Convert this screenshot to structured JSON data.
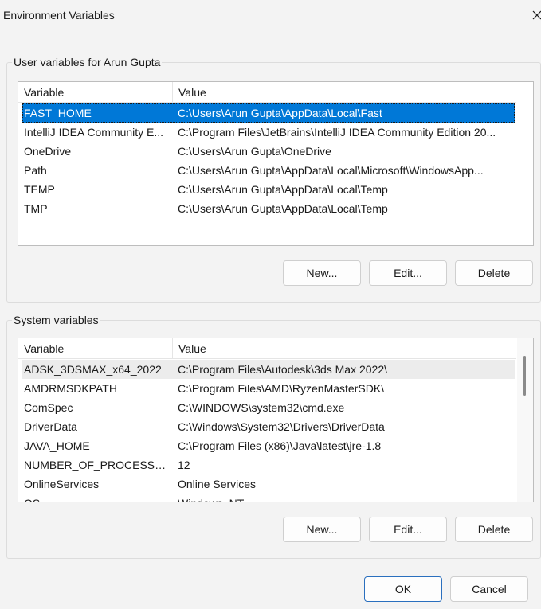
{
  "window": {
    "title": "Environment Variables"
  },
  "user_vars": {
    "group_label": "User variables for Arun Gupta",
    "columns": [
      "Variable",
      "Value"
    ],
    "rows": [
      {
        "variable": "FAST_HOME",
        "value": "C:\\Users\\Arun Gupta\\AppData\\Local\\Fast"
      },
      {
        "variable": "IntelliJ IDEA Community E...",
        "value": "C:\\Program Files\\JetBrains\\IntelliJ IDEA Community Edition 20..."
      },
      {
        "variable": "OneDrive",
        "value": "C:\\Users\\Arun Gupta\\OneDrive"
      },
      {
        "variable": "Path",
        "value": "C:\\Users\\Arun Gupta\\AppData\\Local\\Microsoft\\WindowsApp..."
      },
      {
        "variable": "TEMP",
        "value": "C:\\Users\\Arun Gupta\\AppData\\Local\\Temp"
      },
      {
        "variable": "TMP",
        "value": "C:\\Users\\Arun Gupta\\AppData\\Local\\Temp"
      }
    ],
    "selected_row": "FAST_HOME",
    "buttons": {
      "new": "New...",
      "edit": "Edit...",
      "delete": "Delete"
    }
  },
  "system_vars": {
    "group_label": "System variables",
    "columns": [
      "Variable",
      "Value"
    ],
    "rows": [
      {
        "variable": "ADSK_3DSMAX_x64_2022",
        "value": "C:\\Program Files\\Autodesk\\3ds Max 2022\\"
      },
      {
        "variable": "AMDRMSDKPATH",
        "value": "C:\\Program Files\\AMD\\RyzenMasterSDK\\"
      },
      {
        "variable": "ComSpec",
        "value": "C:\\WINDOWS\\system32\\cmd.exe"
      },
      {
        "variable": "DriverData",
        "value": "C:\\Windows\\System32\\Drivers\\DriverData"
      },
      {
        "variable": "JAVA_HOME",
        "value": "C:\\Program Files (x86)\\Java\\latest\\jre-1.8"
      },
      {
        "variable": "NUMBER_OF_PROCESSORS",
        "value": "12"
      },
      {
        "variable": "OnlineServices",
        "value": "Online Services"
      },
      {
        "variable": "OS",
        "value": "Windows_NT"
      }
    ],
    "hovered_row": "ADSK_3DSMAX_x64_2022",
    "buttons": {
      "new": "New...",
      "edit": "Edit...",
      "delete": "Delete"
    }
  },
  "footer": {
    "ok": "OK",
    "cancel": "Cancel"
  },
  "colors": {
    "selection": "#0078d7",
    "window_bg": "#f3f3f3",
    "primary_border": "#2a6fbe"
  },
  "icons": {
    "close": "close-icon"
  }
}
